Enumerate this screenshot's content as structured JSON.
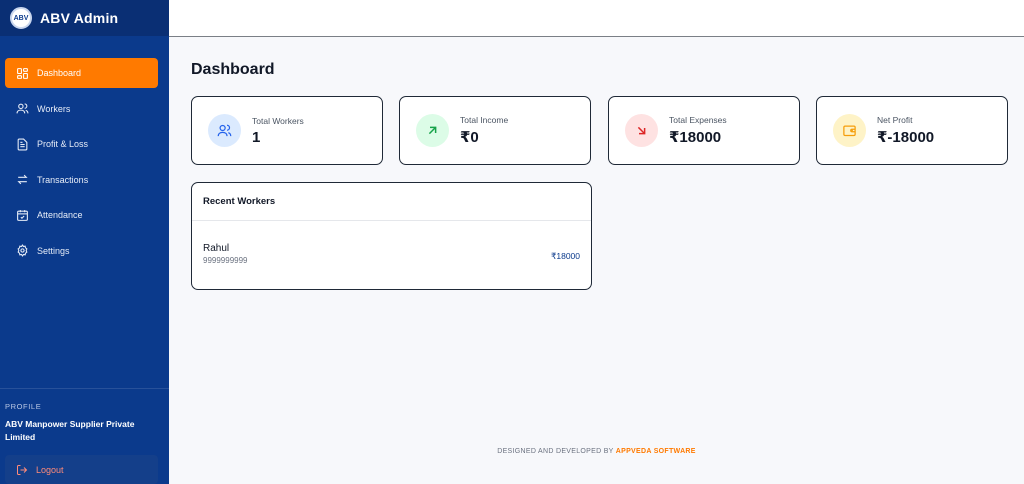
{
  "app": {
    "title": "ABV Admin",
    "logo_text": "ABV",
    "colors": {
      "sidebar": "#0b3a8c",
      "accent": "#ff7a00"
    }
  },
  "sidebar": {
    "items": [
      {
        "label": "Dashboard",
        "icon": "dashboard-icon",
        "active": true
      },
      {
        "label": "Workers",
        "icon": "users-icon",
        "active": false
      },
      {
        "label": "Profit & Loss",
        "icon": "document-icon",
        "active": false
      },
      {
        "label": "Transactions",
        "icon": "transfer-icon",
        "active": false
      },
      {
        "label": "Attendance",
        "icon": "calendar-icon",
        "active": false
      },
      {
        "label": "Settings",
        "icon": "gear-icon",
        "active": false
      }
    ],
    "profile_label": "PROFILE",
    "profile_name": "ABV Manpower Supplier Private Limited",
    "logout_label": "Logout"
  },
  "main": {
    "page_title": "Dashboard",
    "stats": [
      {
        "label": "Total Workers",
        "value": "1",
        "icon": "users-icon",
        "color": "#2563eb"
      },
      {
        "label": "Total Income",
        "value": "₹0",
        "icon": "arrow-up-right-icon",
        "color": "#16a34a"
      },
      {
        "label": "Total Expenses",
        "value": "₹18000",
        "icon": "arrow-down-right-icon",
        "color": "#dc2626"
      },
      {
        "label": "Net Profit",
        "value": "₹-18000",
        "icon": "wallet-icon",
        "color": "#f59e0b"
      }
    ],
    "recent_workers": {
      "title": "Recent Workers",
      "rows": [
        {
          "name": "Rahul",
          "phone": "9999999999",
          "amount": "₹18000"
        }
      ]
    }
  },
  "footer": {
    "prefix": "DESIGNED AND DEVELOPED BY",
    "company": "APPVEDA SOFTWARE"
  }
}
